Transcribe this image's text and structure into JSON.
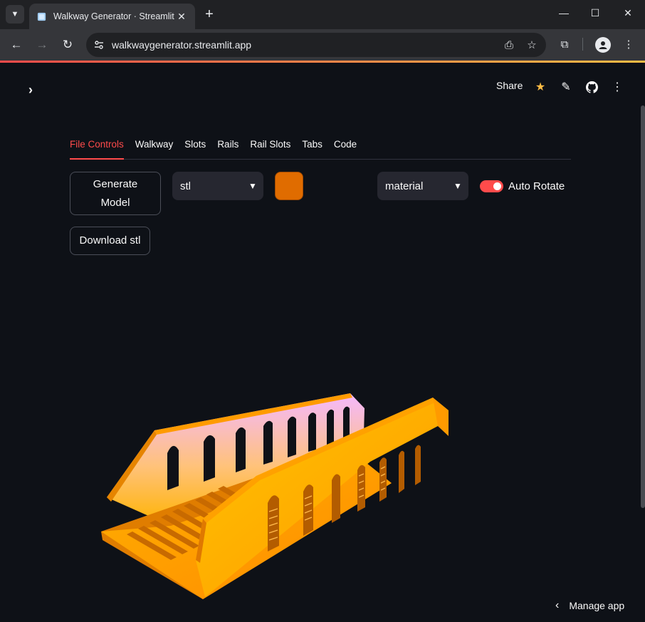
{
  "browser": {
    "tab_title": "Walkway Generator · Streamlit",
    "url": "walkwaygenerator.streamlit.app"
  },
  "header": {
    "share_label": "Share"
  },
  "tabs": [
    {
      "label": "File Controls",
      "active": true
    },
    {
      "label": "Walkway",
      "active": false
    },
    {
      "label": "Slots",
      "active": false
    },
    {
      "label": "Rails",
      "active": false
    },
    {
      "label": "Rail Slots",
      "active": false
    },
    {
      "label": "Tabs",
      "active": false
    },
    {
      "label": "Code",
      "active": false
    }
  ],
  "controls": {
    "generate_line1": "Generate",
    "generate_line2": "Model",
    "format_select": "stl",
    "color_value": "#e06c00",
    "material_select": "material",
    "auto_rotate_label": "Auto Rotate",
    "auto_rotate_on": true,
    "download_label": "Download stl"
  },
  "footer": {
    "manage_label": "Manage app"
  },
  "colors": {
    "accent": "#ff4b4b",
    "background": "#0e1117",
    "model_orange": "#ff9e00",
    "model_pink": "#f2b3ff"
  }
}
